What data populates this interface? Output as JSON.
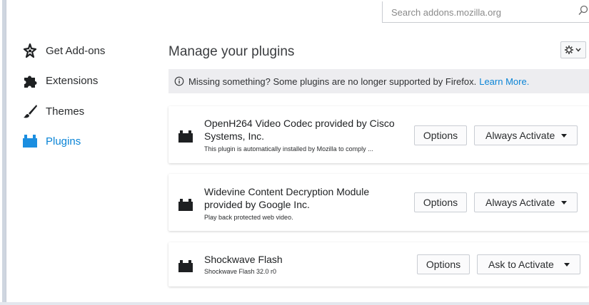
{
  "search": {
    "placeholder": "Search addons.mozilla.org"
  },
  "sidebar": {
    "items": [
      {
        "label": "Get Add-ons",
        "icon": "get-addons-icon"
      },
      {
        "label": "Extensions",
        "icon": "puzzle-icon"
      },
      {
        "label": "Themes",
        "icon": "brush-icon"
      },
      {
        "label": "Plugins",
        "icon": "plugin-icon",
        "selected": true
      }
    ]
  },
  "main": {
    "title": "Manage your plugins",
    "notice": {
      "text": "Missing something? Some plugins are no longer supported by Firefox.",
      "link": "Learn More."
    },
    "plugins": [
      {
        "name": "OpenH264 Video Codec provided by Cisco Systems, Inc.",
        "description": "This plugin is automatically installed by Mozilla to comply ...",
        "options_label": "Options",
        "activation": "Always Activate"
      },
      {
        "name": "Widevine Content Decryption Module provided by Google Inc.",
        "description": "Play back protected web video.",
        "options_label": "Options",
        "activation": "Always Activate"
      },
      {
        "name": "Shockwave Flash",
        "description": "Shockwave Flash 32.0 r0",
        "options_label": "Options",
        "activation": "Ask to Activate"
      }
    ]
  },
  "colors": {
    "accent": "#0a84d6",
    "notice_bg": "#ededf0",
    "text": "#222426"
  }
}
